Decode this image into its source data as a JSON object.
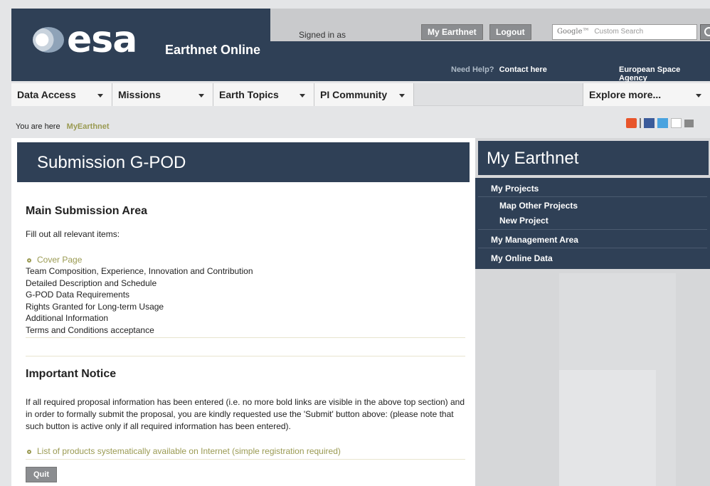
{
  "header": {
    "logo_text": "esa",
    "site_title": "Earthnet Online",
    "signed_in": "Signed in as",
    "my_earthnet_btn": "My Earthnet",
    "logout_btn": "Logout",
    "search_brand": "Google™",
    "search_placeholder": "Custom Search",
    "need_help": "Need Help?",
    "contact": "Contact here",
    "agency": "European Space Agency"
  },
  "nav": {
    "items": [
      "Data Access",
      "Missions",
      "Earth Topics",
      "PI Community",
      "Explore more..."
    ]
  },
  "breadcrumb": {
    "label": "You are here",
    "current": "MyEarthnet"
  },
  "main": {
    "title": "Submission G-POD",
    "section1_title": "Main Submission Area",
    "section1_intro": "Fill out all relevant items:",
    "cover_page": "Cover Page",
    "items": [
      "Team Composition, Experience, Innovation and Contribution",
      "Detailed Description and Schedule",
      "G-POD Data Requirements",
      "Rights Granted for Long-term Usage",
      "Additional Information",
      "Terms and Conditions acceptance"
    ],
    "section2_title": "Important Notice",
    "notice": "If all required proposal information has been entered (i.e. no more bold links are visible in the above top section) and in order to formally submit the proposal, you are kindly requested use the 'Submit' button above: (please note that such button is active only if all required information has been entered).",
    "products_link": "List of products systematically available on Internet (simple registration required)",
    "quit_btn": "Quit"
  },
  "sidebar": {
    "title": "My Earthnet",
    "my_projects": "My Projects",
    "map_other": "Map Other Projects",
    "new_project": "New Project",
    "management": "My Management Area",
    "online_data": "My Online Data"
  }
}
